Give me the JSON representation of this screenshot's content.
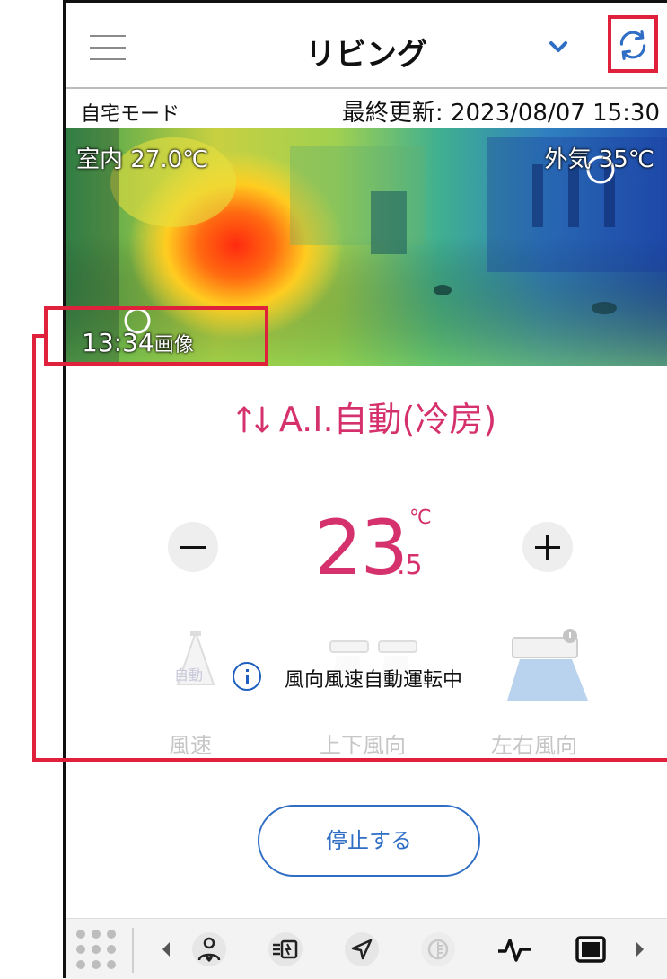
{
  "header": {
    "title": "リビング"
  },
  "status": {
    "mode": "自宅モード",
    "last_update": "最終更新: 2023/08/07 15:30"
  },
  "thermal_image": {
    "indoor": "室内 27.0℃",
    "outdoor": "外気 35℃",
    "time": "13:34",
    "time_suffix": "画像"
  },
  "operation": {
    "mode": "A.I.自動(冷房)"
  },
  "temperature": {
    "integer": "23",
    "decimal": ".5",
    "unit": "℃"
  },
  "wind": {
    "fan_auto": "自動",
    "info": "風向風速自動運転中",
    "labels": {
      "speed": "風速",
      "vertical": "上下風向",
      "horizontal": "左右風向"
    }
  },
  "stop": {
    "label": "停止する"
  },
  "colors": {
    "accent_pink": "#d5316d",
    "accent_blue": "#2f6ec4",
    "highlight_red": "#e0213b"
  },
  "bottom_nav": {
    "icons": [
      "grid-icon",
      "chevron-left-icon",
      "person-heart-icon",
      "power-saving-icon",
      "location-icon",
      "disabled-mode-icon",
      "activity-icon",
      "display-icon",
      "chevron-right-icon"
    ]
  }
}
